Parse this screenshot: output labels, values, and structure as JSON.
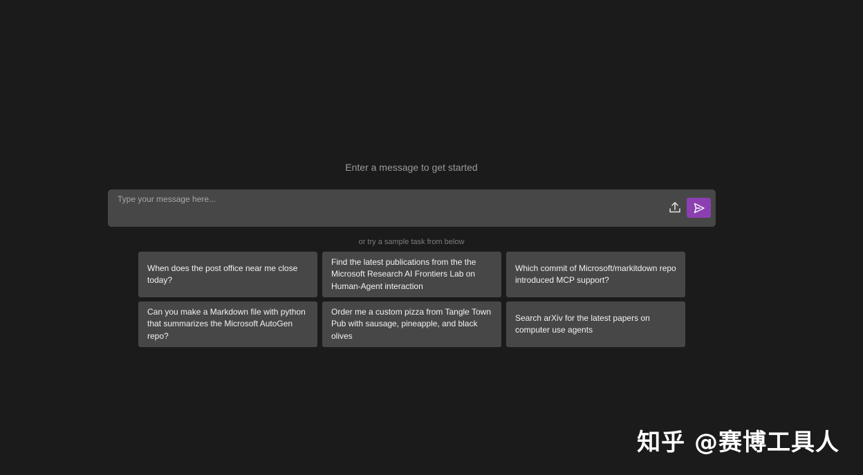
{
  "prompt": {
    "heading": "Enter a message to get started"
  },
  "input": {
    "placeholder": "Type your message here...",
    "value": ""
  },
  "icons": {
    "upload": "upload-icon",
    "send": "send-icon"
  },
  "colors": {
    "background": "#1b1b1b",
    "surface": "#474747",
    "accent": "#8b3fb0"
  },
  "samples": {
    "hint": "or try a sample task from below",
    "tasks": [
      "When does the post office near me close today?",
      "Find the latest publications from the the Microsoft Research AI Frontiers Lab on Human-Agent interaction",
      "Which commit of Microsoft/markitdown repo introduced MCP support?",
      "Can you make a Markdown file with python that summarizes the Microsoft AutoGen repo?",
      "Order me a custom pizza from Tangle Town Pub with sausage, pineapple, and black olives",
      "Search arXiv for the latest papers on computer use agents"
    ]
  },
  "watermark": "知乎 @赛博工具人"
}
